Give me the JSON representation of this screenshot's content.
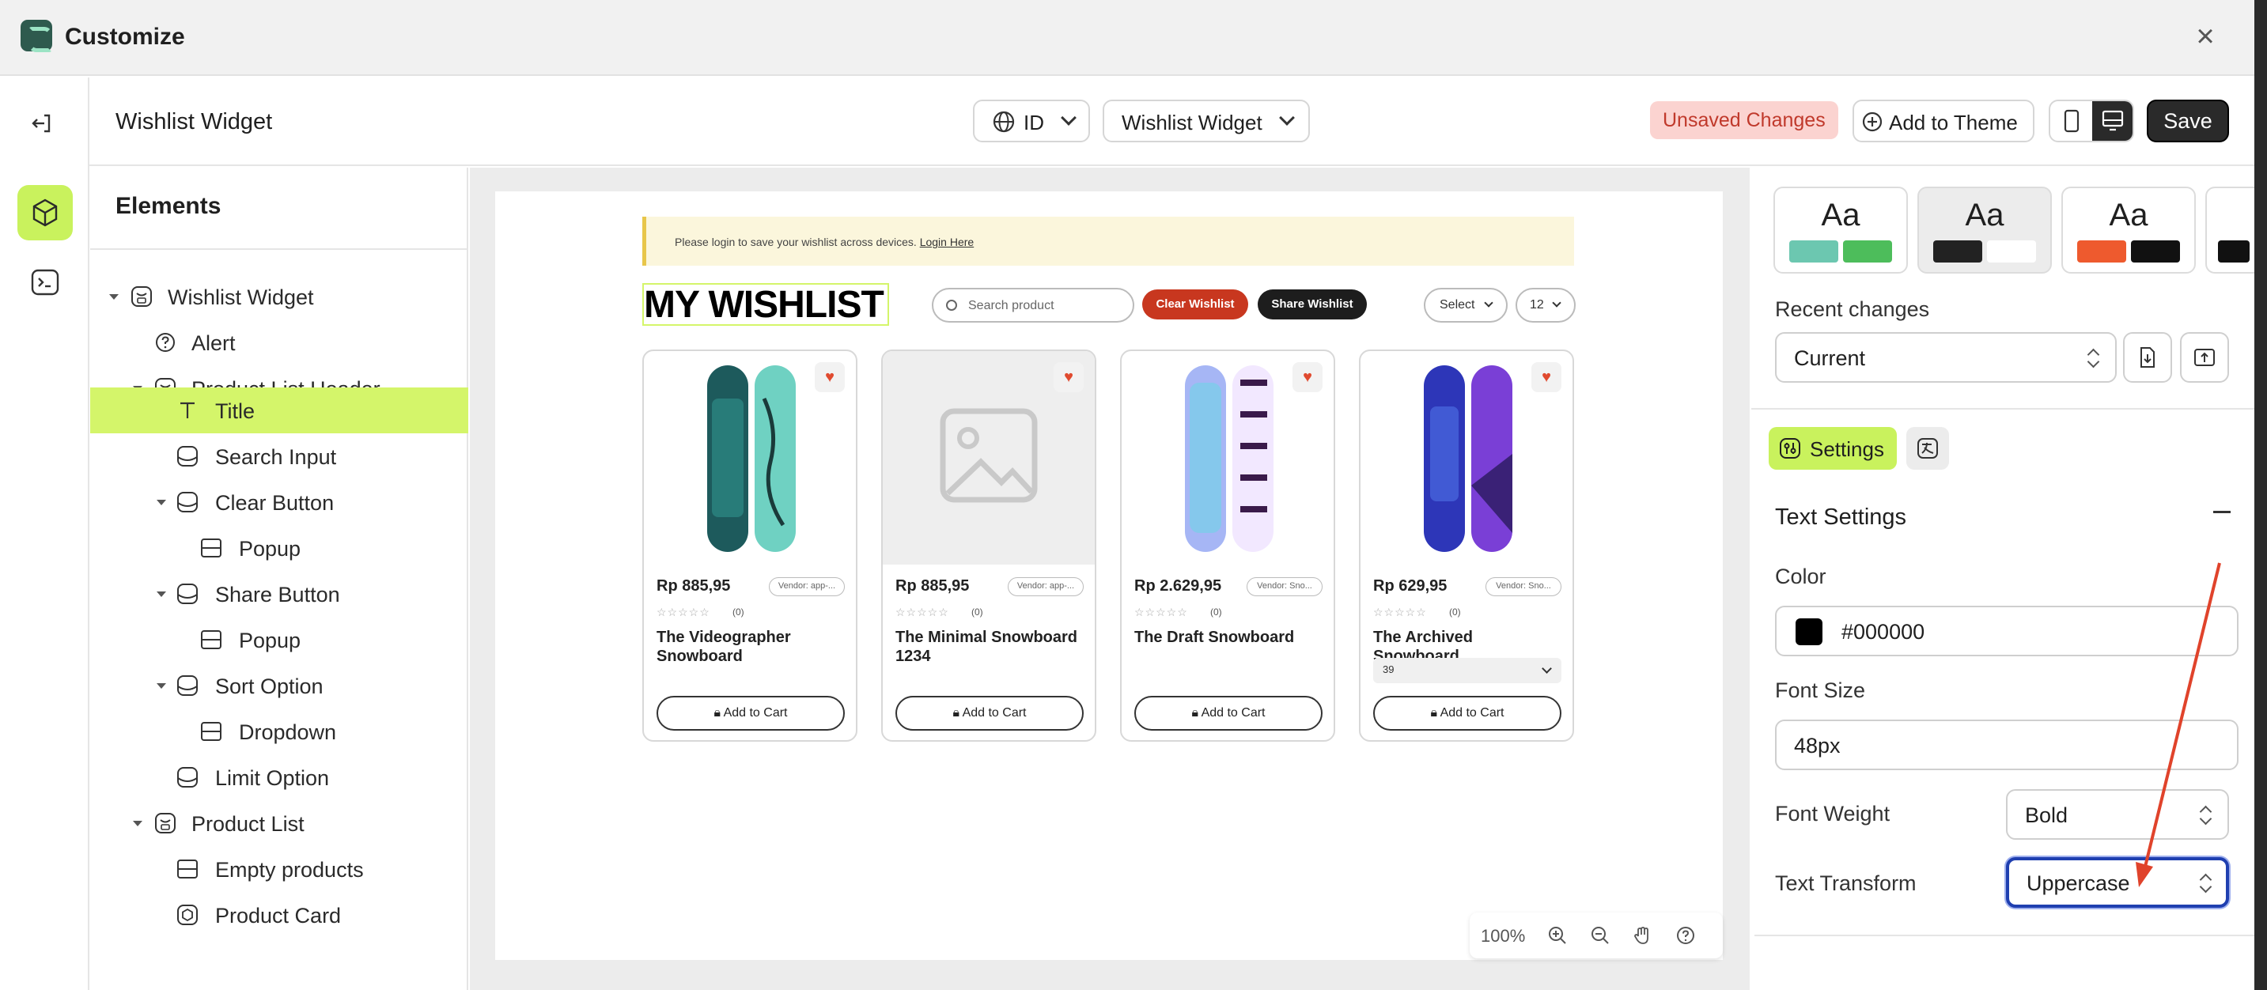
{
  "window": {
    "title": "Customize"
  },
  "toolbar": {
    "page_name": "Wishlist Widget",
    "language": "ID",
    "template_select": "Wishlist Widget",
    "unsaved_label": "Unsaved Changes",
    "add_to_theme_label": "Add to Theme",
    "save_label": "Save"
  },
  "elements": {
    "heading": "Elements",
    "items": [
      {
        "label": "Wishlist Widget",
        "level": 0,
        "expanded": true,
        "icon": "component-icon"
      },
      {
        "label": "Alert",
        "level": 1,
        "icon": "help-circle-icon"
      },
      {
        "label": "Product List Header",
        "level": 1,
        "expanded": true,
        "icon": "component-icon"
      },
      {
        "label": "Title",
        "level": 2,
        "icon": "text-icon",
        "selected": true
      },
      {
        "label": "Search Input",
        "level": 2,
        "icon": "block-icon"
      },
      {
        "label": "Clear Button",
        "level": 2,
        "expanded": true,
        "icon": "block-icon"
      },
      {
        "label": "Popup",
        "level": 3,
        "icon": "section-icon"
      },
      {
        "label": "Share Button",
        "level": 2,
        "expanded": true,
        "icon": "block-icon"
      },
      {
        "label": "Popup",
        "level": 3,
        "icon": "section-icon"
      },
      {
        "label": "Sort Option",
        "level": 2,
        "expanded": true,
        "icon": "block-icon"
      },
      {
        "label": "Dropdown",
        "level": 3,
        "icon": "section-icon"
      },
      {
        "label": "Limit Option",
        "level": 2,
        "icon": "block-icon"
      },
      {
        "label": "Product List",
        "level": 1,
        "expanded": true,
        "icon": "component-icon"
      },
      {
        "label": "Empty products",
        "level": 2,
        "icon": "section-icon"
      },
      {
        "label": "Product Card",
        "level": 2,
        "icon": "box-icon"
      }
    ]
  },
  "preview": {
    "alert_text": "Please login to save your wishlist across devices.",
    "alert_link": "Login Here",
    "title": "MY WISHLIST",
    "search_placeholder": "Search product",
    "clear_label": "Clear Wishlist",
    "share_label": "Share Wishlist",
    "sort_label": "Select",
    "limit_label": "12",
    "products": [
      {
        "price": "Rp 885,95",
        "vendor": "Vendor: app-...",
        "reviews": "(0)",
        "name": "The Videographer Snowboard",
        "cart": "Add to Cart",
        "image": "board-teal"
      },
      {
        "price": "Rp 885,95",
        "vendor": "Vendor: app-...",
        "reviews": "(0)",
        "name": "The Minimal Snowboard 1234",
        "cart": "Add to Cart",
        "image": "placeholder"
      },
      {
        "price": "Rp 2.629,95",
        "vendor": "Vendor: Sno...",
        "reviews": "(0)",
        "name": "The Draft Snowboard",
        "cart": "Add to Cart",
        "image": "board-purple"
      },
      {
        "price": "Rp 629,95",
        "vendor": "Vendor: Sno...",
        "reviews": "(0)",
        "name": "The Archived Snowboard",
        "variant": "39",
        "cart": "Add to Cart",
        "image": "board-blue"
      }
    ],
    "zoom": "100%"
  },
  "properties": {
    "themes": [
      {
        "label": "Aa",
        "colors": [
          "#6cc7b0",
          "#4dbd5b"
        ]
      },
      {
        "label": "Aa",
        "colors": [
          "#222222",
          "#ffffff"
        ]
      },
      {
        "label": "Aa",
        "colors": [
          "#ee5a2e",
          "#111111"
        ]
      }
    ],
    "recent_changes_label": "Recent changes",
    "recent_changes_value": "Current",
    "settings_tab": "Settings",
    "section_title": "Text Settings",
    "color_label": "Color",
    "color_value": "#000000",
    "font_size_label": "Font Size",
    "font_size_value": "48px",
    "font_weight_label": "Font Weight",
    "font_weight_value": "Bold",
    "text_transform_label": "Text Transform",
    "text_transform_value": "Uppercase"
  },
  "colors": {
    "accent": "#c9f25d",
    "danger": "#c0392b",
    "focus": "#1f3fb0",
    "annotation_arrow": "#e0432b"
  }
}
